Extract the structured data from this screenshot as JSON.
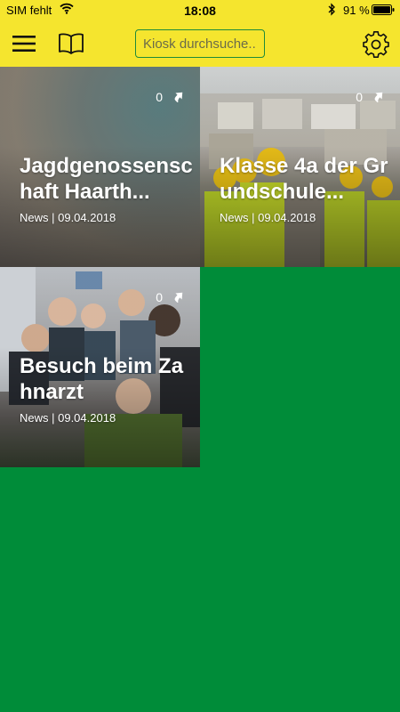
{
  "status_bar": {
    "carrier": "SIM fehlt",
    "time": "18:08",
    "battery": "91 %"
  },
  "header": {
    "menu_icon": "hamburger-menu-icon",
    "book_icon": "open-book-icon",
    "search_placeholder": "Kiosk durchsuche...",
    "settings_icon": "gear-icon"
  },
  "tiles": [
    {
      "title": "Jagdgenossenschaft Haarth...",
      "category": "News",
      "date": "09.04.2018",
      "meta": "News | 09.04.2018",
      "count": "0",
      "image": "blurred gray-teal photo"
    },
    {
      "title": "Klasse 4a der Grundschule...",
      "category": "News",
      "date": "09.04.2018",
      "meta": "News | 09.04.2018",
      "count": "0",
      "image": "children in yellow safety vests and hard hats at recycling bales"
    },
    {
      "title": "Besuch beim Zahnarzt",
      "category": "News",
      "date": "09.04.2018",
      "meta": "News | 09.04.2018",
      "count": "0",
      "image": "children gathered in a dentist office"
    }
  ],
  "colors": {
    "header_yellow": "#f5e52e",
    "background_green": "#008c39",
    "search_border": "#1f8b3a"
  }
}
